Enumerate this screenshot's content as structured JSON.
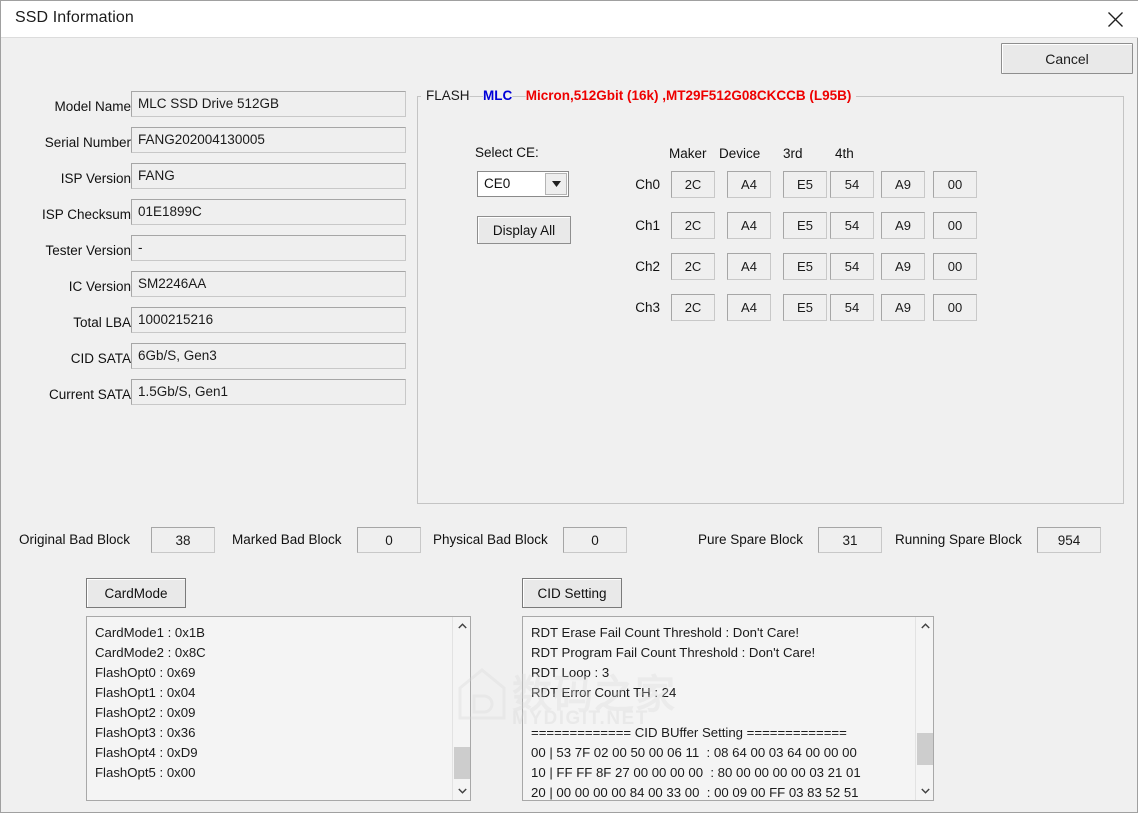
{
  "window": {
    "title": "SSD Information",
    "close_icon": "close-icon"
  },
  "toolbar": {
    "cancel_label": "Cancel"
  },
  "info_fields": [
    {
      "label": "Model Name",
      "value": "MLC SSD Drive 512GB"
    },
    {
      "label": "Serial Number",
      "value": "FANG202004130005"
    },
    {
      "label": "ISP Version",
      "value": "FANG"
    },
    {
      "label": "ISP Checksum",
      "value": "01E1899C"
    },
    {
      "label": "Tester Version",
      "value": "-"
    },
    {
      "label": "IC Version",
      "value": "SM2246AA"
    },
    {
      "label": "Total LBA",
      "value": "1000215216"
    },
    {
      "label": "CID SATA",
      "value": "6Gb/S, Gen3"
    },
    {
      "label": "Current SATA",
      "value": "1.5Gb/S, Gen1"
    }
  ],
  "flash": {
    "group_title_prefix": "FLASH",
    "group_title_type": "MLC",
    "group_title_part": "Micron,512Gbit (16k) ,MT29F512G08CKCCB (L95B)",
    "select_ce_label": "Select CE:",
    "select_ce_value": "CE0",
    "select_ce_options": [
      "CE0"
    ],
    "display_all_label": "Display All",
    "column_headers": [
      "Maker",
      "Device",
      "3rd",
      "4th"
    ],
    "rows": [
      {
        "channel": "Ch0",
        "cells": [
          "2C",
          "A4",
          "E5",
          "54",
          "A9",
          "00"
        ]
      },
      {
        "channel": "Ch1",
        "cells": [
          "2C",
          "A4",
          "E5",
          "54",
          "A9",
          "00"
        ]
      },
      {
        "channel": "Ch2",
        "cells": [
          "2C",
          "A4",
          "E5",
          "54",
          "A9",
          "00"
        ]
      },
      {
        "channel": "Ch3",
        "cells": [
          "2C",
          "A4",
          "E5",
          "54",
          "A9",
          "00"
        ]
      }
    ]
  },
  "block_stats": [
    {
      "label": "Original Bad Block",
      "value": "38"
    },
    {
      "label": "Marked Bad Block",
      "value": "0"
    },
    {
      "label": "Physical Bad Block",
      "value": "0"
    },
    {
      "label": "Pure Spare Block",
      "value": "31"
    },
    {
      "label": "Running Spare Block",
      "value": "954"
    }
  ],
  "card_mode": {
    "button_label": "CardMode",
    "lines": [
      "CardMode1 : 0x1B",
      "CardMode2 : 0x8C",
      "FlashOpt0 : 0x69",
      "FlashOpt1 : 0x04",
      "FlashOpt2 : 0x09",
      "FlashOpt3 : 0x36",
      "FlashOpt4 : 0xD9",
      "FlashOpt5 : 0x00"
    ]
  },
  "cid_setting": {
    "button_label": "CID Setting",
    "lines": [
      "RDT Erase Fail Count Threshold : Don't Care!",
      "RDT Program Fail Count Threshold : Don't Care!",
      "RDT Loop : 3",
      "RDT Error Count TH : 24",
      "",
      "============= CID BUffer Setting =============",
      "00 | 53 7F 02 00 50 00 06 11  : 08 64 00 03 64 00 00 00",
      "10 | FF FF 8F 27 00 00 00 00  : 80 00 00 00 00 03 21 01",
      "20 | 00 00 00 00 84 00 33 00  : 00 09 00 FF 03 83 52 51"
    ]
  },
  "watermark": {
    "chinese": "数码之家",
    "site": "MYDIGIT.NET"
  },
  "colors": {
    "dialog_bg": "#f0f0f0",
    "title_bg": "#ffffff",
    "field_bg": "#efefef",
    "blue_text": "#0000d8",
    "red_text": "#ee0000"
  }
}
